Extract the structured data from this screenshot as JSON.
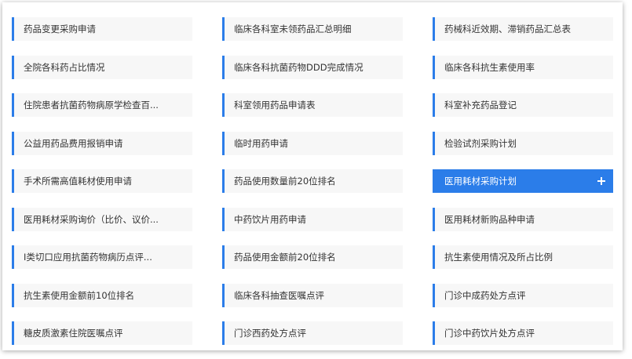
{
  "accent_color": "#2b7de9",
  "active_index": 14,
  "active_icon": "plus-icon",
  "items": [
    "药品变更采购申请",
    "临床各科室未领药品汇总明细",
    "药械科近效期、滞销药品汇总表",
    "全院各科药占比情况",
    "临床各科抗菌药物DDD完成情况",
    "临床各科抗生素使用率",
    "住院患者抗菌药物病原学检查百...",
    "科室领用药品申请表",
    "科室补充药品登记",
    "公益用药品费用报销申请",
    "临时用药申请",
    "检验试剂采购计划",
    "手术所需高值耗材使用申请",
    "药品使用数量前20位排名",
    "医用耗材采购计划",
    "医用耗材采购询价（比价、议价...",
    "中药饮片用药申请",
    "医用耗材新购品种申请",
    "I类切口应用抗菌药物病历点评...",
    "药品使用金额前20位排名",
    "抗生素使用情况及所占比例",
    "抗生素使用金额前10位排名",
    "临床各科抽查医嘱点评",
    "门诊中成药处方点评",
    "糖皮质激素住院医嘱点评",
    "门诊西药处方点评",
    "门诊中药饮片处方点评"
  ]
}
